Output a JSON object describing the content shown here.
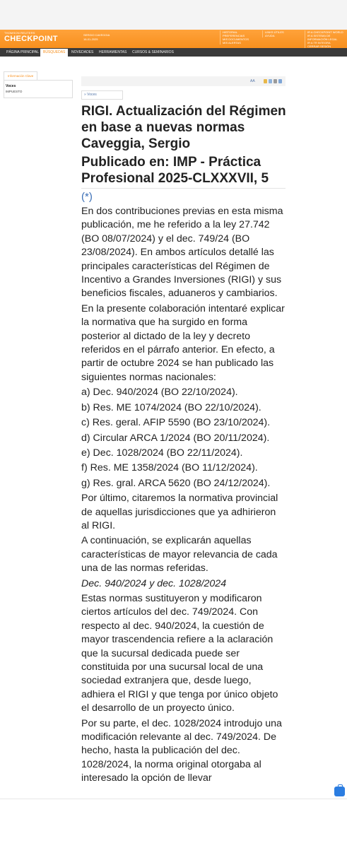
{
  "header": {
    "brand_small": "THOMSON REUTERS",
    "brand_big": "CHECKPOINT",
    "user_name": "SERGIO CAVEGGIA",
    "user_date": "16-01-2025",
    "links_col1": [
      "HISTORIAL",
      "PREFERENCIAS",
      "MIS DOCUMENTOS",
      "MIS ALERTAS"
    ],
    "links_col2": [
      "LINKS ÚTILES",
      "AYUDA"
    ],
    "links_col3": [
      "IR A CHECKPOINT WORLD",
      "IR A SISTEMA DE",
      "INFORMACIÓN LEGAL",
      "IR A TR INTEGRA",
      "CERRAR SESIÓN"
    ],
    "brand_color": "#f7901e"
  },
  "nav": {
    "items": [
      "PÁGINA PRINCIPAL",
      "BÚSQUEDAS",
      "NOVEDADES",
      "HERRAMIENTAS",
      "CURSOS & SEMINARIOS"
    ],
    "active_index": 1
  },
  "sidebar": {
    "tab_label": "Información Clave",
    "heading": "Voces",
    "value": "IMPUESTO"
  },
  "toolbar": {
    "font_control": "AA",
    "icons": [
      "save-icon",
      "document-icon",
      "print-icon",
      "email-icon"
    ]
  },
  "voces_link": "» Voces",
  "article": {
    "title": "RIGI. Actualización del Régimen en base a nuevas normas Caveggia, Sergio",
    "published": "Publicado en: IMP - Práctica Profesional 2025-CLXXXVII, 5",
    "footnote_marker": "(*)",
    "paragraphs": [
      "En dos contribuciones previas en esta misma publicación, me he referido a la ley 27.742 (BO 08/07/2024) y el dec. 749/24 (BO 23/08/2024). En ambos artículos detallé las principales características del Régimen de Incentivo a Grandes Inversiones (RIGI) y sus beneficios fiscales, aduaneros y cambiarios.",
      "En la presente colaboración intentaré explicar la normativa que ha surgido en forma posterior al dictado de la ley y decreto referidos en el párrafo anterior. En efecto, a partir de octubre 2024 se han publicado las siguientes normas nacionales:",
      "a) Dec. 940/2024 (BO 22/10/2024).",
      "b) Res. ME 1074/2024 (BO 22/10/2024).",
      "c) Res. geral. AFIP 5590 (BO 23/10/2024).",
      "d) Circular ARCA 1/2024 (BO 20/11/2024).",
      "e) Dec. 1028/2024 (BO 22/11/2024).",
      "f) Res. ME 1358/2024 (BO 11/12/2024).",
      "g) Res. gral. ARCA 5620 (BO 24/12/2024).",
      "Por último, citaremos la normativa provincial de aquellas jurisdicciones que ya adhirieron al RIGI.",
      "A continuación, se explicarán aquellas características de mayor relevancia de cada una de las normas referidas.",
      "Dec. 940/2024 y dec. 1028/2024",
      "Estas normas sustituyeron y modificaron ciertos artículos del dec. 749/2024. Con respecto al dec. 940/2024, la cuestión de mayor trascendencia refiere a la aclaración que la sucursal dedicada puede ser constituida por una sucursal local de una sociedad extranjera que, desde luego, adhiera el RIGI y que tenga por único objeto el desarrollo de un proyecto único.",
      "Por su parte, el dec. 1028/2024 introdujo una modificación relevante al dec. 749/2024. De hecho, hasta la publicación del dec. 1028/2024, la norma original otorgaba al interesado la opción de llevar"
    ]
  },
  "float_button": "briefcase-icon"
}
